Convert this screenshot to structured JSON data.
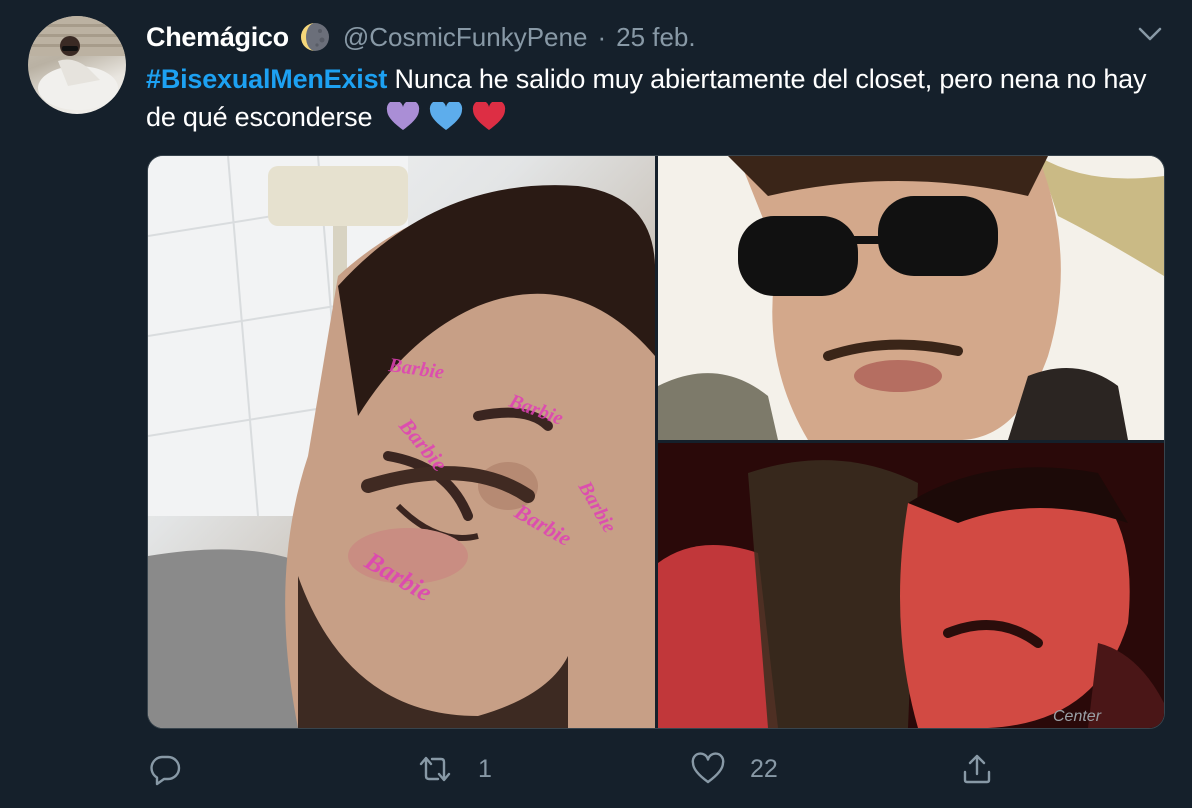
{
  "user": {
    "display_name": "Chemágico",
    "name_emoji": "moon-icon",
    "handle": "@CosmicFunkyPene",
    "separator": "·",
    "date": "25 feb."
  },
  "tweet": {
    "hashtag": "#BisexualMenExist",
    "body": " Nunca he salido muy abiertamente del closet, pero nena no hay de qué esconderse",
    "emoji": [
      "purple-heart-icon",
      "blue-heart-icon",
      "red-heart-icon"
    ]
  },
  "media": {
    "count": 3,
    "face_sticker_text": "Barbie",
    "sign_text": "Center"
  },
  "actions": {
    "reply_count": "",
    "retweet_count": "1",
    "like_count": "22",
    "share_count": ""
  },
  "colors": {
    "background": "#15202b",
    "accent": "#1da1f2",
    "muted": "#8899a6",
    "border": "#38444d"
  }
}
